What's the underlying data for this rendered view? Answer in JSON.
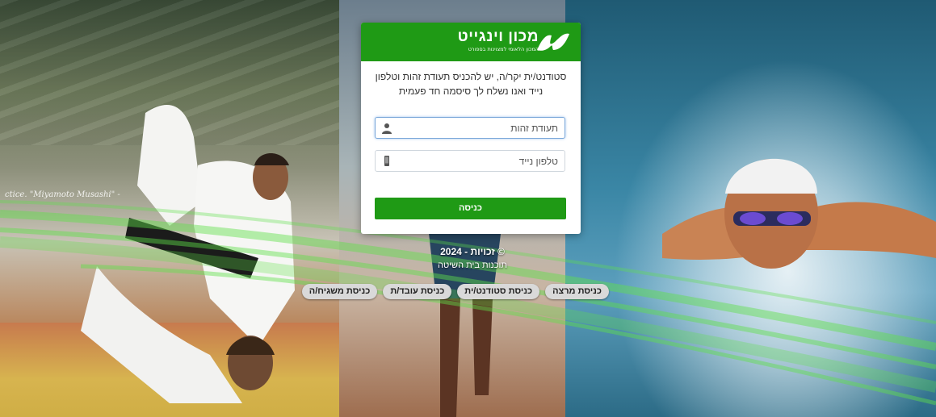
{
  "brand": {
    "name": "מכון וינגייט",
    "tagline": "המכון הלאומי למצוינות בספורט",
    "header_color": "#1f9a15"
  },
  "background": {
    "wall_text": "ctice. \"Miyamoto Musashi\" -"
  },
  "login": {
    "instructions": "סטודנט/ית יקר/ה, יש להכניס תעודת זהות וטלפון נייד ואנו נשלח לך סיסמה חד פעמית",
    "id_field": {
      "placeholder": "תעודת זהות",
      "value": "",
      "icon": "user-icon"
    },
    "phone_field": {
      "placeholder": "טלפון נייד",
      "value": "",
      "icon": "mobile-phone-icon"
    },
    "submit_label": "כניסה"
  },
  "footer": {
    "copyright": "© זכויות - 2024",
    "credit": "תוכנות בית השיטה"
  },
  "entry_links": [
    {
      "label": "כניסת מרצה"
    },
    {
      "label": "כניסת סטודנט/ית"
    },
    {
      "label": "כניסת עובד/ת"
    },
    {
      "label": "כניסת משגיח/ה"
    }
  ]
}
